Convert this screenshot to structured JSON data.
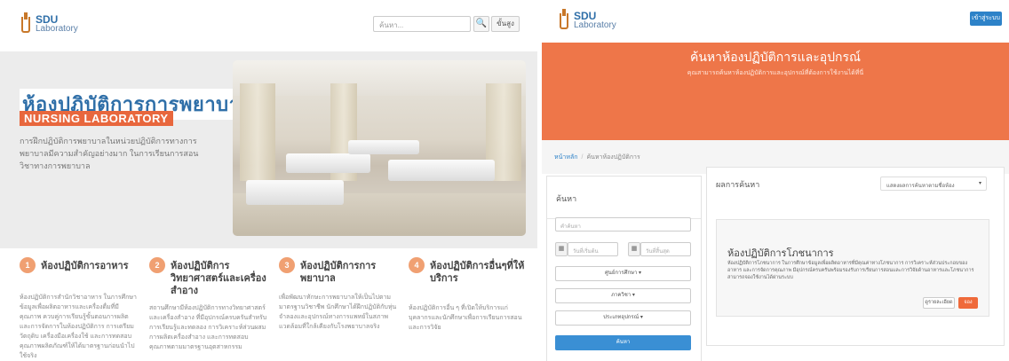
{
  "logo": {
    "line1": "SDU",
    "line2": "Laboratory"
  },
  "left": {
    "search_placeholder": "ค้นหา...",
    "search_icon_glyph": "🔍",
    "lang_label": "ขั้นสูง",
    "hero": {
      "title": "ห้องปฏิบัติการการพยาบาล",
      "subtitle": "NURSING LABORATORY",
      "description": "การฝึกปฏิบัติการพยาบาลในหน่วยปฏิบัติการทางการพยาบาลมีความสำคัญอย่างมาก ในการเรียนการสอนวิชาทางการพยาบาล"
    },
    "features": [
      {
        "num": "1",
        "title": "ห้องปฏิบัติการอาหาร",
        "desc": "ห้องปฏิบัติการสำนักวิชาอาหาร ในการศึกษาข้อมูลเพื่อผลิตอาหารและเครื่องดื่มที่มีคุณภาพ ควบคู่การเรียนรู้ขั้นตอนการผลิตและการจัดการในห้องปฏิบัติการ การเตรียมวัตถุดิบ เครื่องมือเครื่องใช้ และการทดสอบคุณภาพผลิตภัณฑ์ให้ได้มาตรฐานก่อนนำไปใช้จริง"
      },
      {
        "num": "2",
        "title": "ห้องปฏิบัติการวิทยาศาสตร์และเครื่องสำอาง",
        "desc": "สถานศึกษามีห้องปฏิบัติการทางวิทยาศาสตร์และเครื่องสำอาง ที่มีอุปกรณ์ครบครันสำหรับการเรียนรู้และทดลอง การวิเคราะห์ส่วนผสม การผลิตเครื่องสำอาง และการทดสอบคุณภาพตามมาตรฐานอุตสาหกรรม"
      },
      {
        "num": "3",
        "title": "ห้องปฏิบัติการการพยาบาล",
        "desc": "เพื่อพัฒนาทักษะการพยาบาลให้เป็นไปตามมาตรฐานวิชาชีพ นักศึกษาได้ฝึกปฏิบัติกับหุ่นจำลองและอุปกรณ์ทางการแพทย์ในสภาพแวดล้อมที่ใกล้เคียงกับโรงพยาบาลจริง"
      },
      {
        "num": "4",
        "title": "ห้องปฏิบัติการอื่นๆที่ให้บริการ",
        "desc": "ห้องปฏิบัติการอื่น ๆ ที่เปิดให้บริการแก่บุคลากรและนักศึกษาเพื่อการเรียนการสอนและการวิจัย"
      }
    ]
  },
  "right": {
    "home_label": "เข้าสู่ระบบ",
    "banner": {
      "title": "ค้นหาห้องปฏิบัติการและอุปกรณ์",
      "subtitle": "คุณสามารถค้นหาห้องปฏิบัติการและอุปกรณ์ที่ต้องการใช้งานได้ที่นี่"
    },
    "breadcrumb": {
      "home": "หน้าหลัก",
      "current": "ค้นหาห้องปฏิบัติการ"
    },
    "search_panel": {
      "title": "ค้นหา",
      "keyword_placeholder": "คำค้นหา",
      "start_date_placeholder": "วันที่เริ่มต้น",
      "end_date_placeholder": "วันที่สิ้นสุด",
      "calendar_glyph": "▦",
      "dropdown1": "ศูนย์การศึกษา ▾",
      "dropdown2": "ภาควิชา ▾",
      "dropdown3": "ประเภทอุปกรณ์ ▾",
      "submit": "ค้นหา"
    },
    "results": {
      "title": "ผลการค้นหา",
      "sort_label": "แสดงผลการค้นหาตามชื่อห้อง",
      "sort_caret": "▾",
      "card": {
        "title": "ห้องปฏิบัติการโภชนาการ",
        "desc": "ห้องปฏิบัติการโภชนาการ ในการศึกษาข้อมูลเพื่อผลิตอาหารที่มีคุณค่าทางโภชนาการ การวิเคราะห์ส่วนประกอบของอาหาร และการจัดการคุณภาพ มีอุปกรณ์ครบครันพร้อมรองรับการเรียนการสอนและการวิจัยด้านอาหารและโภชนาการ สามารถจองใช้งานได้ผ่านระบบ",
        "detail_label": "ดูรายละเอียด",
        "book_label": "จอง"
      }
    }
  }
}
